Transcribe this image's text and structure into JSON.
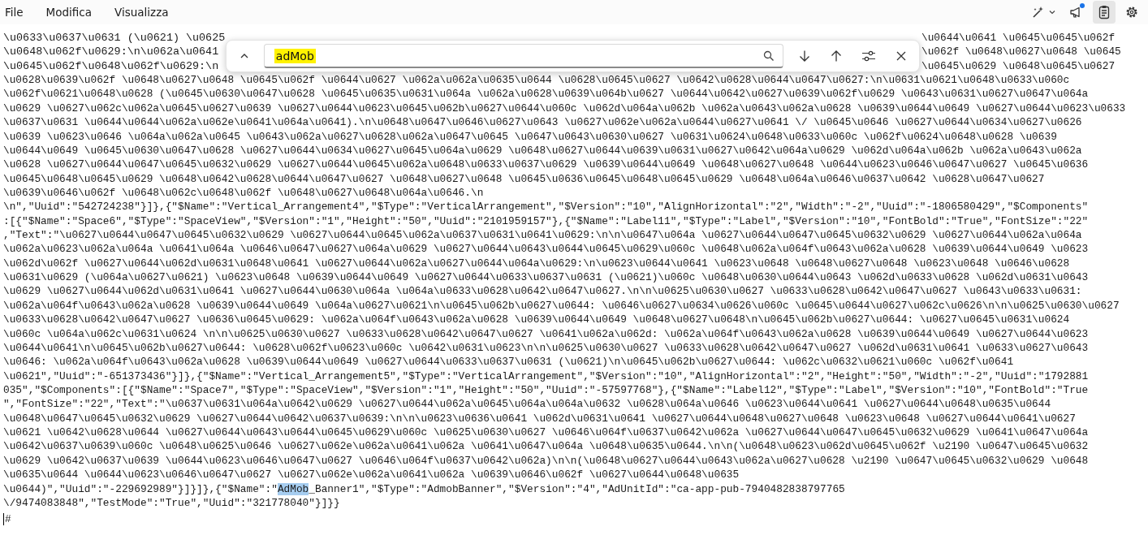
{
  "menu": [
    {
      "label": "File"
    },
    {
      "label": "Modifica"
    },
    {
      "label": "Visualizza"
    }
  ],
  "toolbar": [
    {
      "kind": "wand",
      "selected": false,
      "badge": false
    },
    {
      "kind": "feedback",
      "selected": false,
      "badge": true
    },
    {
      "kind": "clipboard",
      "selected": true,
      "badge": false
    },
    {
      "kind": "settings",
      "selected": false,
      "badge": false
    }
  ],
  "find": {
    "query": "adMob",
    "query_highlighted": true
  },
  "lines": [
    {
      "kind": "covered",
      "left": "\\u0633\\u0637\\u0631 (\\u0621) \\u0625",
      "right": "\\u0644\\u0641 \\u0645\\u0645\\u062f"
    },
    {
      "kind": "covered",
      "left": "\\u0648\\u062f\\u0629:\\n\\u062a\\u0641",
      "right": "\\u062f \\u0648\\u0627\\u0648 \\u0645"
    },
    {
      "kind": "covered",
      "left": "\\u0645\\u062f\\u0648\\u062f\\u0629:\\n",
      "right": "\\u0645\\u0629 \\u0648\\u0645\\u0627"
    },
    {
      "kind": "plain",
      "text": "\\u0628\\u0639\\u062f \\u0648\\u0627\\u0648 \\u0645\\u062f \\u0644\\u0627 \\u062a\\u062a\\u0635\\u0644 \\u0628\\u0645\\u0627 \\u0642\\u0628\\u0644\\u0647\\u0627:\\n\\u0631\\u0621\\u0648\\u0633\\u060c"
    },
    {
      "kind": "plain",
      "text": "\\u062f\\u0621\\u0648\\u0628 (\\u0645\\u0630\\u0647\\u0628 \\u0645\\u0635\\u0631\\u064a \\u062a\\u0628\\u0639\\u064b\\u0627 \\u0644\\u0642\\u0627\\u0639\\u062f\\u0629 \\u0643\\u0631\\u0627\\u0647\\u064a"
    },
    {
      "kind": "plain",
      "text": "\\u0629 \\u0627\\u062c\\u062a\\u0645\\u0627\\u0639 \\u0627\\u0644\\u0623\\u0645\\u062b\\u0627\\u0644\\u060c \\u062d\\u064a\\u062b \\u062a\\u0643\\u062a\\u0628 \\u0639\\u0644\\u0649 \\u0627\\u0644\\u0623\\u0633"
    },
    {
      "kind": "plain",
      "text": "\\u0637\\u0631 \\u0644\\u0644\\u062a\\u062e\\u0641\\u064a\\u0641).\\n\\u0648\\u0647\\u0646\\u0627\\u0643 \\u0627\\u062e\\u062a\\u0644\\u0627\\u0641 \\/ \\u0645\\u0646 \\u0627\\u0644\\u0634\\u0627\\u0626"
    },
    {
      "kind": "plain",
      "text": "\\u0639 \\u0623\\u0646 \\u064a\\u062a\\u0645 \\u0643\\u062a\\u0627\\u0628\\u062a\\u0647\\u0645 \\u0647\\u0643\\u0630\\u0627 \\u0631\\u0624\\u0648\\u0633\\u060c \\u062f\\u0624\\u0648\\u0628 \\u0639"
    },
    {
      "kind": "plain",
      "text": "\\u0644\\u0649 \\u0645\\u0630\\u0647\\u0628 \\u0627\\u0644\\u0634\\u0627\\u0645\\u064a\\u0629 \\u0648\\u0627\\u0644\\u0639\\u0631\\u0627\\u0642\\u064a\\u0629 \\u062d\\u064a\\u062b \\u062a\\u0643\\u062a"
    },
    {
      "kind": "plain",
      "text": "\\u0628 \\u0627\\u0644\\u0647\\u0645\\u0632\\u0629 \\u0627\\u0644\\u0645\\u062a\\u0648\\u0633\\u0637\\u0629 \\u0639\\u0644\\u0649 \\u0648\\u0627\\u0648 \\u0644\\u0623\\u0646\\u0647\\u0627 \\u0645\\u0636"
    },
    {
      "kind": "plain",
      "text": "\\u0645\\u0648\\u0645\\u0629 \\u0648\\u0642\\u0628\\u0644\\u0647\\u0627 \\u0648\\u0627\\u0648 \\u0645\\u0636\\u0645\\u0648\\u0645\\u0629 \\u0648\\u064a\\u0646\\u0637\\u0642 \\u0628\\u0647\\u0627"
    },
    {
      "kind": "plain",
      "text": "\\u0639\\u0646\\u062f \\u0648\\u062c\\u0648\\u062f \\u0648\\u0627\\u0648\\u064a\\u0646.\\n"
    },
    {
      "kind": "plain",
      "text": "\\n\",\"Uuid\":\"542724238\"}]},{\"$Name\":\"Vertical_Arrangement4\",\"$Type\":\"VerticalArrangement\",\"$Version\":\"10\",\"AlignHorizontal\":\"2\",\"Width\":\"-2\",\"Uuid\":\"-1806580429\",\"$Components\""
    },
    {
      "kind": "plain",
      "text": ":[{\"$Name\":\"Space6\",\"$Type\":\"SpaceView\",\"$Version\":\"1\",\"Height\":\"50\",\"Uuid\":\"2101959157\"},{\"$Name\":\"Label11\",\"$Type\":\"Label\",\"$Version\":\"10\",\"FontBold\":\"True\",\"FontSize\":\"22\""
    },
    {
      "kind": "plain",
      "text": ",\"Text\":\"\\u0627\\u0644\\u0647\\u0645\\u0632\\u0629 \\u0627\\u0644\\u0645\\u062a\\u0637\\u0631\\u0641\\u0629:\\n\\n\\u0647\\u064a \\u0627\\u0644\\u0647\\u0645\\u0632\\u0629 \\u0627\\u0644\\u062a\\u064a"
    },
    {
      "kind": "plain",
      "text": "\\u062a\\u0623\\u062a\\u064a \\u0641\\u064a \\u0646\\u0647\\u0627\\u064a\\u0629 \\u0627\\u0644\\u0643\\u0644\\u0645\\u0629\\u060c \\u0648\\u062a\\u064f\\u0643\\u062a\\u0628 \\u0639\\u0644\\u0649 \\u0623"
    },
    {
      "kind": "plain",
      "text": "\\u062d\\u062f \\u0627\\u0644\\u062d\\u0631\\u0648\\u0641 \\u0627\\u0644\\u062a\\u0627\\u0644\\u064a\\u0629:\\n\\u0623\\u0644\\u0641 \\u0623\\u0648 \\u0648\\u0627\\u0648 \\u0623\\u0648 \\u0646\\u0628"
    },
    {
      "kind": "plain",
      "text": "\\u0631\\u0629 (\\u064a\\u0627\\u0621) \\u0623\\u0648 \\u0639\\u0644\\u0649 \\u0627\\u0644\\u0633\\u0637\\u0631 (\\u0621)\\u060c \\u0648\\u0630\\u0644\\u0643 \\u062d\\u0633\\u0628 \\u062d\\u0631\\u0643"
    },
    {
      "kind": "plain",
      "text": "\\u0629 \\u0627\\u0644\\u062d\\u0631\\u0641 \\u0627\\u0644\\u0630\\u064a \\u064a\\u0633\\u0628\\u0642\\u0647\\u0627.\\n\\n\\u0625\\u0630\\u0627 \\u0633\\u0628\\u0642\\u0647\\u0627 \\u0643\\u0633\\u0631:"
    },
    {
      "kind": "plain",
      "text": "\\u062a\\u064f\\u0643\\u062a\\u0628 \\u0639\\u0644\\u0649 \\u064a\\u0627\\u0621\\n\\u0645\\u062b\\u0627\\u0644: \\u0646\\u0627\\u0634\\u0626\\u060c \\u0645\\u0644\\u0627\\u062c\\u0626\\n\\n\\u0625\\u0630\\u0627"
    },
    {
      "kind": "plain",
      "text": "\\u0633\\u0628\\u0642\\u0647\\u0627 \\u0636\\u0645\\u0629: \\u062a\\u064f\\u0643\\u062a\\u0628 \\u0639\\u0644\\u0649 \\u0648\\u0627\\u0648\\n\\u0645\\u062b\\u0627\\u0644: \\u0627\\u0645\\u0631\\u0624"
    },
    {
      "kind": "plain",
      "text": "\\u060c \\u064a\\u062c\\u0631\\u0624 \\n\\n\\u0625\\u0630\\u0627 \\u0633\\u0628\\u0642\\u0647\\u0627 \\u0641\\u062a\\u062d: \\u062a\\u064f\\u0643\\u062a\\u0628 \\u0639\\u0644\\u0649 \\u0627\\u0644\\u0623"
    },
    {
      "kind": "plain",
      "text": "\\u0644\\u0641\\n\\u0645\\u062b\\u0627\\u0644: \\u0628\\u062f\\u0623\\u060c \\u0642\\u0631\\u0623\\n\\n\\u0625\\u0630\\u0627 \\u0633\\u0628\\u0642\\u0647\\u0627 \\u062d\\u0631\\u0641 \\u0633\\u0627\\u0643"
    },
    {
      "kind": "plain",
      "text": "\\u0646: \\u062a\\u064f\\u0643\\u062a\\u0628 \\u0639\\u0644\\u0649 \\u0627\\u0644\\u0633\\u0637\\u0631 (\\u0621)\\n\\u0645\\u062b\\u0627\\u0644: \\u062c\\u0632\\u0621\\u060c \\u062f\\u0641"
    },
    {
      "kind": "plain",
      "text": "\\u0621\",\"Uuid\":\"-651373436\"}]},{\"$Name\":\"Vertical_Arrangement5\",\"$Type\":\"VerticalArrangement\",\"$Version\":\"10\",\"AlignHorizontal\":\"2\",\"Height\":\"50\",\"Width\":\"-2\",\"Uuid\":\"1792881"
    },
    {
      "kind": "plain",
      "text": "035\",\"$Components\":[{\"$Name\":\"Space7\",\"$Type\":\"SpaceView\",\"$Version\":\"1\",\"Height\":\"50\",\"Uuid\":\"-57597768\"},{\"$Name\":\"Label12\",\"$Type\":\"Label\",\"$Version\":\"10\",\"FontBold\":\"True"
    },
    {
      "kind": "plain",
      "text": "\",\"FontSize\":\"22\",\"Text\":\"\\u0637\\u0631\\u064a\\u0642\\u0629 \\u0627\\u0644\\u062a\\u0645\\u064a\\u064a\\u0632 \\u0628\\u064a\\u0646 \\u0623\\u0644\\u0641 \\u0627\\u0644\\u0648\\u0635\\u0644"
    },
    {
      "kind": "plain",
      "text": "\\u0648\\u0647\\u0645\\u0632\\u0629 \\u0627\\u0644\\u0642\\u0637\\u0639:\\n\\n\\u0623\\u0636\\u0641 \\u062d\\u0631\\u0641 \\u0627\\u0644\\u0648\\u0627\\u0648 \\u0623\\u0648 \\u0627\\u0644\\u0641\\u0627"
    },
    {
      "kind": "plain",
      "text": "\\u0621 \\u0642\\u0628\\u0644 \\u0627\\u0644\\u0643\\u0644\\u0645\\u0629\\u060c \\u0625\\u0630\\u0627 \\u0646\\u064f\\u0637\\u0642\\u062a \\u0627\\u0644\\u0647\\u0645\\u0632\\u0629 \\u0641\\u0647\\u064a"
    },
    {
      "kind": "plain",
      "text": "\\u0642\\u0637\\u0639\\u060c \\u0648\\u0625\\u0646 \\u0627\\u062e\\u062a\\u0641\\u062a \\u0641\\u0647\\u064a \\u0648\\u0635\\u0644.\\n\\n(\\u0648\\u0623\\u062d\\u0645\\u062f \\u2190 \\u0647\\u0645\\u0632"
    },
    {
      "kind": "plain",
      "text": "\\u0629 \\u0642\\u0637\\u0639 \\u0644\\u0623\\u0646\\u0647\\u0627 \\u0646\\u064f\\u0637\\u0642\\u062a)\\n\\n(\\u0648\\u0627\\u0644\\u0643\\u062a\\u0627\\u0628 \\u2190 \\u0647\\u0645\\u0632\\u0629 \\u0648"
    },
    {
      "kind": "plain",
      "text": "\\u0635\\u0644 \\u0644\\u0623\\u0646\\u0647\\u0627 \\u0627\\u062e\\u062a\\u0641\\u062a \\u0639\\u0646\\u062f \\u0627\\u0644\\u0648\\u0635"
    },
    {
      "kind": "parts",
      "parts": [
        {
          "text": "\\u0644)\",\"Uuid\":\"-229692989\"}]}]},{\"$Name\":\"",
          "highlighted": false
        },
        {
          "text": "AdMob",
          "highlighted": true
        },
        {
          "text": "_Banner1\",\"$Type\":\"AdmobBanner\",\"$Version\":\"4\",\"AdUnitId\":\"ca-app-pub-7940482838797765",
          "highlighted": false
        }
      ]
    },
    {
      "kind": "plain",
      "text": "\\/9474083848\",\"TestMode\":\"True\",\"Uuid\":\"321778040\"}]}}"
    },
    {
      "kind": "caret",
      "text": "#"
    }
  ]
}
